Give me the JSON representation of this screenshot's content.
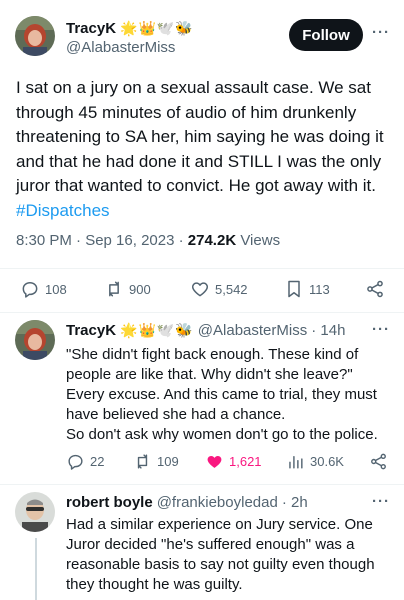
{
  "main_tweet": {
    "author_name": "TracyK",
    "author_emojis": "🌟👑🕊️🐝",
    "author_handle": "@AlabasterMiss",
    "follow_label": "Follow",
    "more_label": "···",
    "text": "I sat on a jury on a sexual assault case. We sat through 45 minutes of audio of him drunkenly threatening to SA her, him saying he was doing it and that he had done it and STILL I was the only juror that wanted to convict. He got away with it.",
    "hashtag": "#Dispatches",
    "time": "8:30 PM · Sep 16, 2023 · ",
    "views_count": "274.2K",
    "views_label": " Views",
    "stats": {
      "replies": "108",
      "reposts": "900",
      "likes": "5,542",
      "bookmarks": "113"
    },
    "icons": [
      "reply-icon",
      "repost-icon",
      "like-icon",
      "bookmark-icon",
      "share-icon"
    ]
  },
  "replies": [
    {
      "author_name": "TracyK",
      "author_emojis": "🌟👑🕊️🐝",
      "author_handle": "@AlabasterMiss",
      "age": "· 14h",
      "more_label": "···",
      "text_lines": [
        "\"She didn't fight back enough. These kind of",
        "people are like that. Why didn't she leave?\"",
        "Every excuse. And this came to trial, they must",
        "have believed she had a chance.",
        "So don't ask why women don't go to the police."
      ],
      "stats": {
        "replies": "22",
        "reposts": "109",
        "likes": "1,621",
        "views": "30.6K"
      },
      "like_active_color": "#f91880"
    },
    {
      "author_name": "robert boyle",
      "author_handle": "@frankieboyledad",
      "age": "· 2h",
      "more_label": "···",
      "text_lines": [
        "Had a similar experience on Jury service. One",
        "Juror decided \"he's suffered enough\" was a",
        "reasonable basis to say not guilty even though",
        "they thought he was guilty."
      ]
    }
  ],
  "colors": {
    "link": "#1d9bf0",
    "text": "#0f1419",
    "secondary": "#536471",
    "like_active": "#f91880"
  }
}
